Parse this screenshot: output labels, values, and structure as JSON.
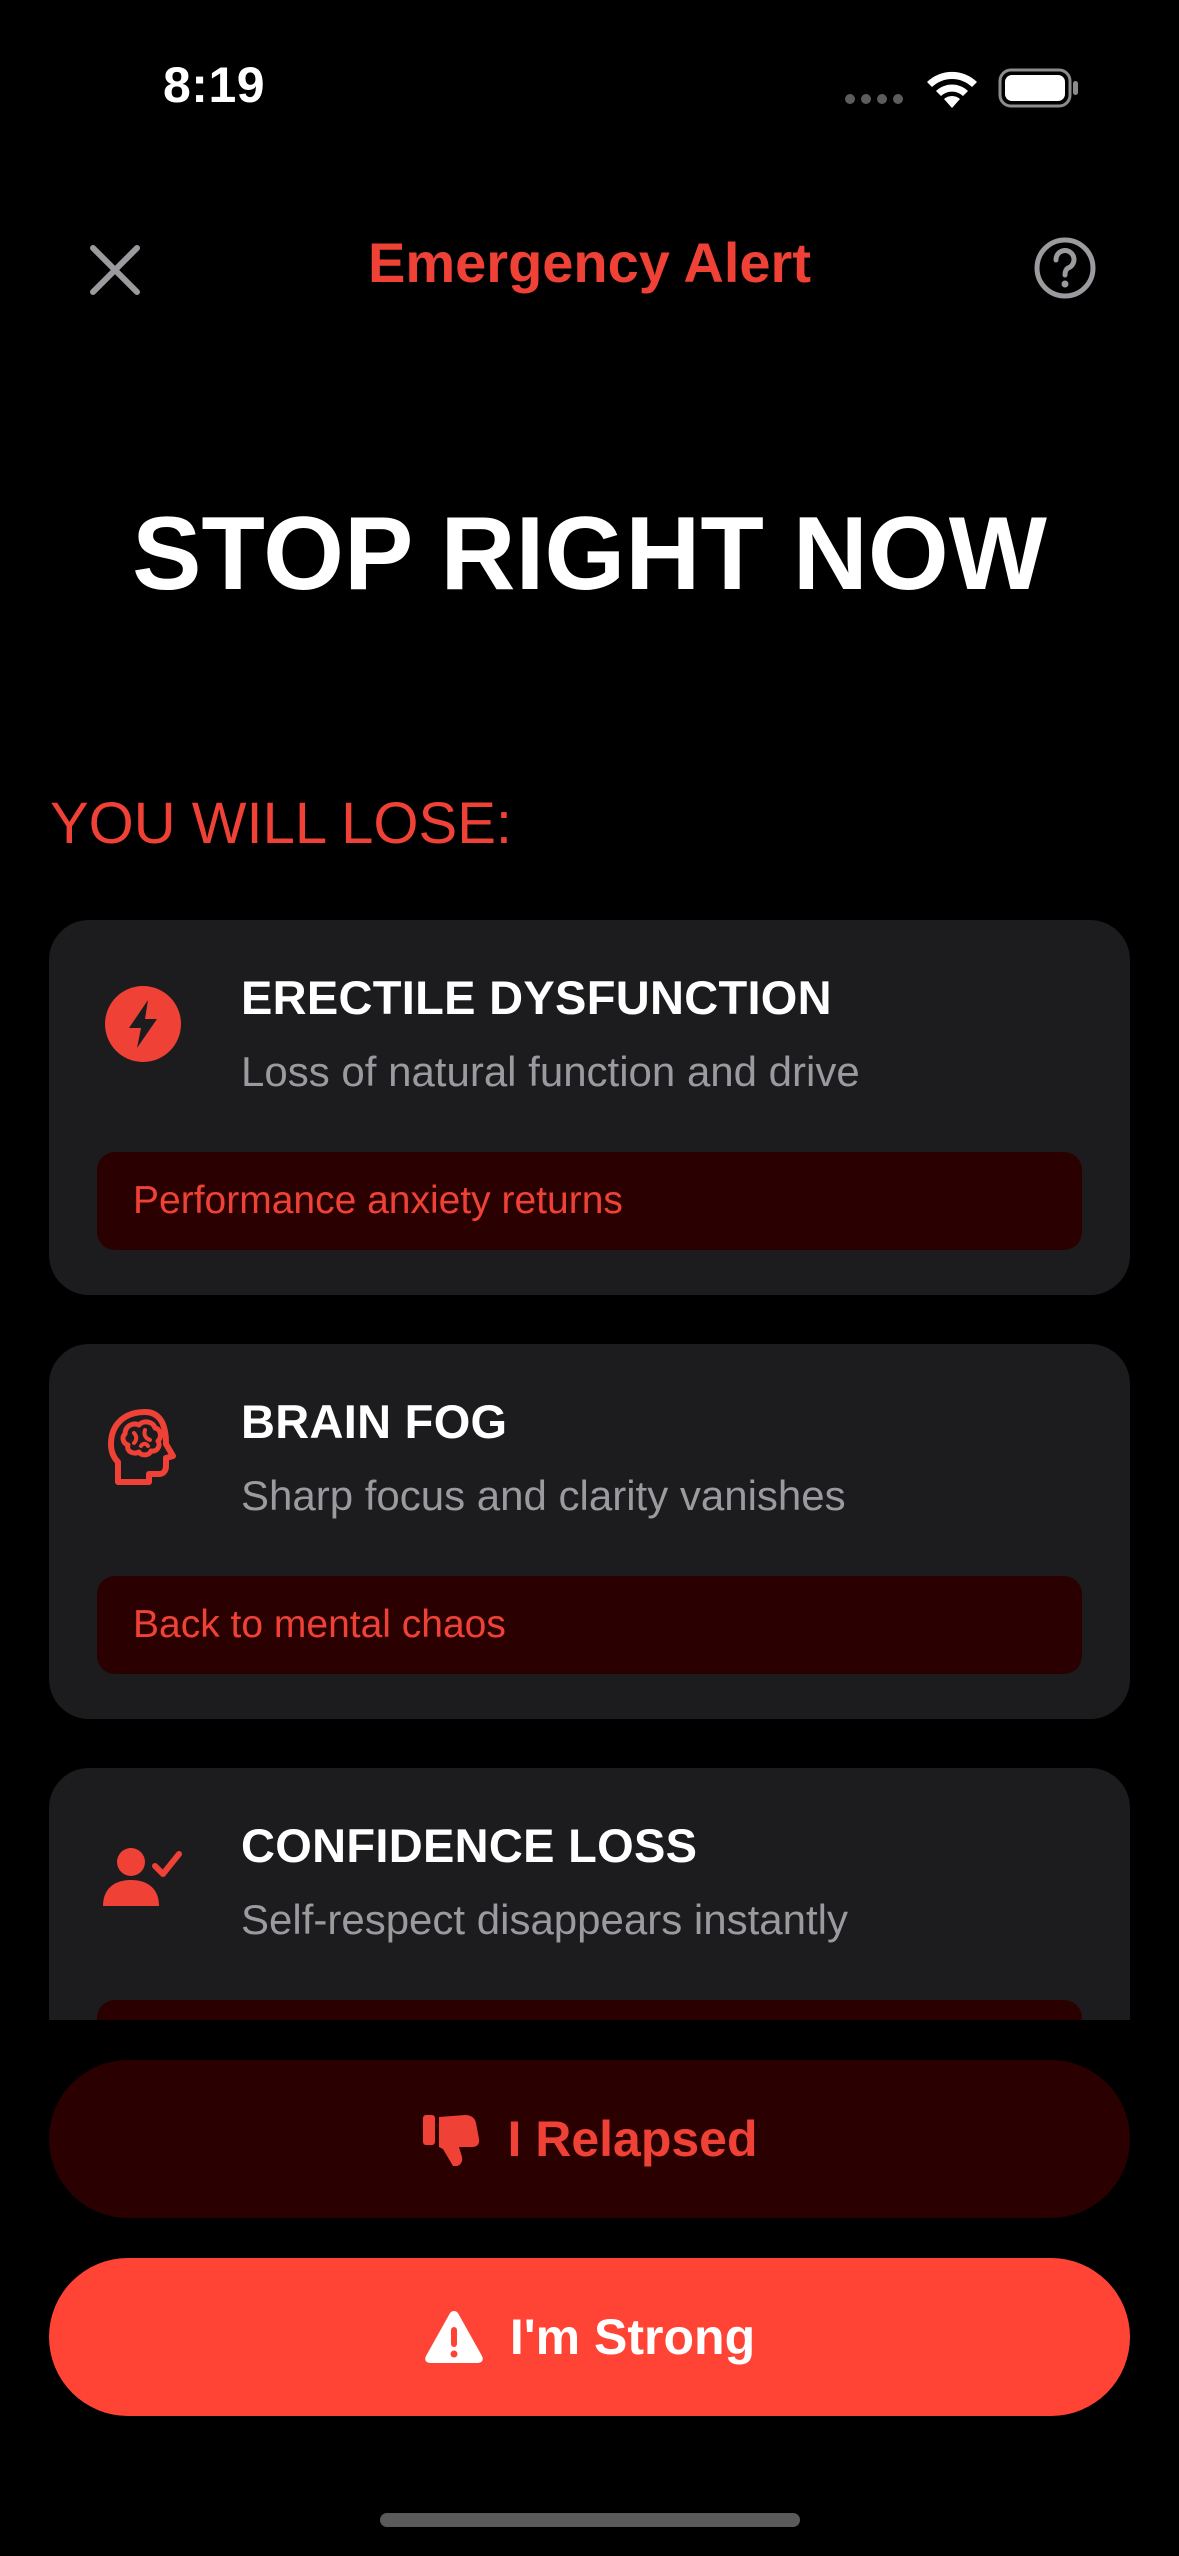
{
  "status_bar": {
    "time": "8:19"
  },
  "nav": {
    "title": "Emergency Alert",
    "close_icon": "close-icon",
    "help_icon": "help-circle-icon"
  },
  "headline": "STOP RIGHT NOW",
  "section_label": "YOU WILL LOSE:",
  "cards": [
    {
      "icon": "lightning-bolt-icon",
      "title": "ERECTILE DYSFUNCTION",
      "subtitle": "Loss of natural function and drive",
      "consequence": "Performance anxiety returns"
    },
    {
      "icon": "brain-head-icon",
      "title": "BRAIN FOG",
      "subtitle": "Sharp focus and clarity vanishes",
      "consequence": "Back to mental chaos"
    },
    {
      "icon": "person-check-icon",
      "title": "CONFIDENCE LOSS",
      "subtitle": "Self-respect disappears instantly",
      "consequence": ""
    }
  ],
  "buttons": {
    "relapsed": {
      "label": "I Relapsed",
      "icon": "thumbs-down-icon"
    },
    "strong": {
      "label": "I'm Strong",
      "icon": "warning-triangle-icon"
    }
  },
  "colors": {
    "background": "#000000",
    "accent_red": "#ef4136",
    "button_red": "#ff4436",
    "card_bg": "#1c1c1e",
    "dark_red_bg": "#2a0000",
    "subtitle_gray": "#9a9a9f"
  }
}
